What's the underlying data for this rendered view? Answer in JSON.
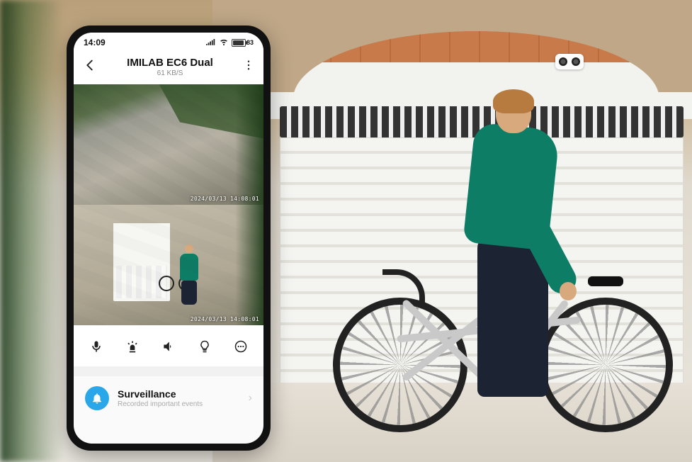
{
  "statusbar": {
    "time": "14:09",
    "battery_percent": "83"
  },
  "header": {
    "title": "IMILAB EC6 Dual",
    "subtitle": "61 KB/S"
  },
  "feeds": {
    "top_timestamp": "2024/03/13 14:08:01",
    "bottom_timestamp": "2024/03/13 14:08:01"
  },
  "controls": {
    "mic": "microphone-icon",
    "siren": "siren-icon",
    "speaker": "speaker-icon",
    "light": "lightbulb-icon",
    "more": "more-controls-icon"
  },
  "list": {
    "surveillance": {
      "title": "Surveillance",
      "subtitle": "Recorded important events"
    }
  },
  "colors": {
    "accent_blue": "#2aa7e8",
    "person_shirt": "#0e7d66"
  }
}
